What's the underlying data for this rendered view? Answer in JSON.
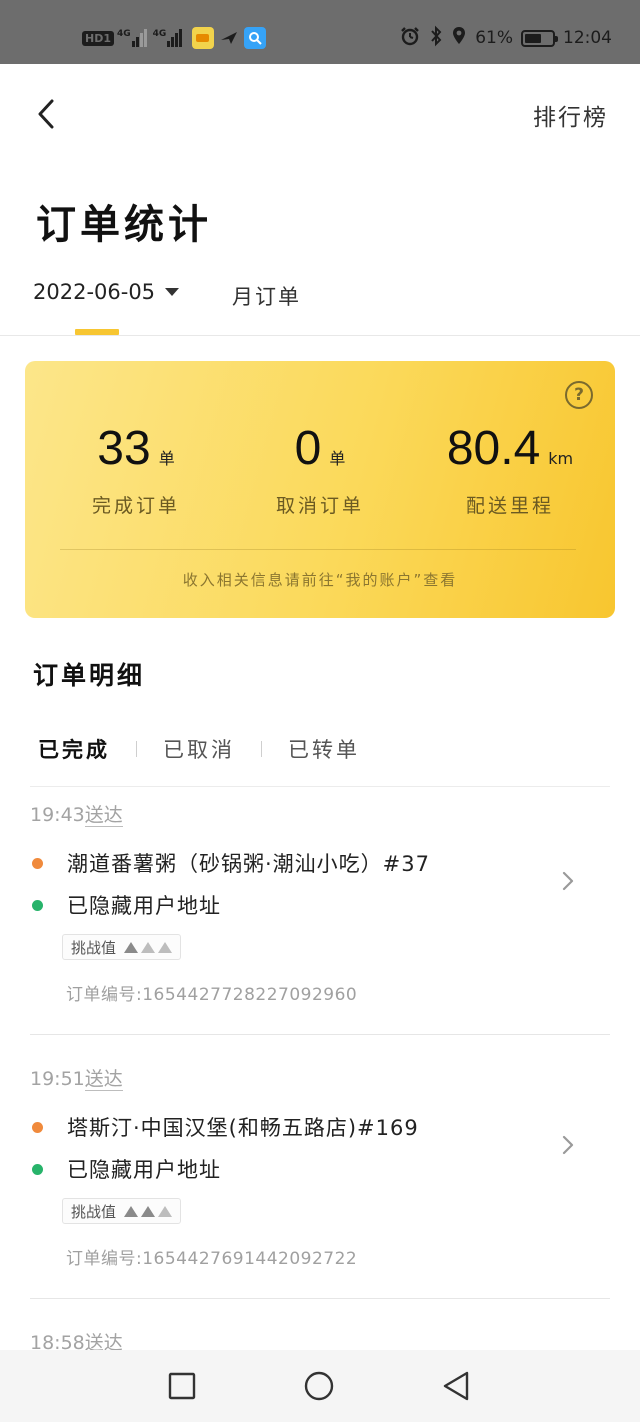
{
  "status_bar": {
    "hd": "HD",
    "hd_num": "1",
    "net1": "4G",
    "net2": "4G",
    "battery": "61%",
    "battery_level": 0.61,
    "time": "12:04"
  },
  "header": {
    "rank_label": "排行榜",
    "title": "订单统计"
  },
  "date_tabs": {
    "date": "2022-06-05",
    "month": "月订单"
  },
  "summary": {
    "completed_value": "33",
    "completed_unit": "单",
    "completed_label": "完成订单",
    "cancelled_value": "0",
    "cancelled_unit": "单",
    "cancelled_label": "取消订单",
    "distance_value": "80.4",
    "distance_unit": "km",
    "distance_label": "配送里程",
    "help": "?",
    "note": "收入相关信息请前往“我的账户”查看"
  },
  "details": {
    "title": "订单明细",
    "tabs": [
      "已完成",
      "已取消",
      "已转单"
    ]
  },
  "orders": [
    {
      "time": "19:43",
      "time_suffix": "送达",
      "shop": "潮道番薯粥（砂锅粥·潮汕小吃）#37",
      "address": "已隐藏用户地址",
      "challenge_label": "挑战值",
      "challenge_level": 1,
      "order_no_label": "订单编号:",
      "order_no": "1654427728227092960"
    },
    {
      "time": "19:51",
      "time_suffix": "送达",
      "shop": "塔斯汀·中国汉堡(和畅五路店)#169",
      "address": "已隐藏用户地址",
      "challenge_label": "挑战值",
      "challenge_level": 2,
      "order_no_label": "订单编号:",
      "order_no": "1654427691442092722"
    },
    {
      "time": "18:58",
      "time_suffix": "送达"
    }
  ],
  "colors": {
    "accent": "#f7c632",
    "card_start": "#fce68a",
    "card_end": "#f8c62f",
    "shop_dot": "#f08a3c",
    "address_dot": "#27b36a"
  }
}
